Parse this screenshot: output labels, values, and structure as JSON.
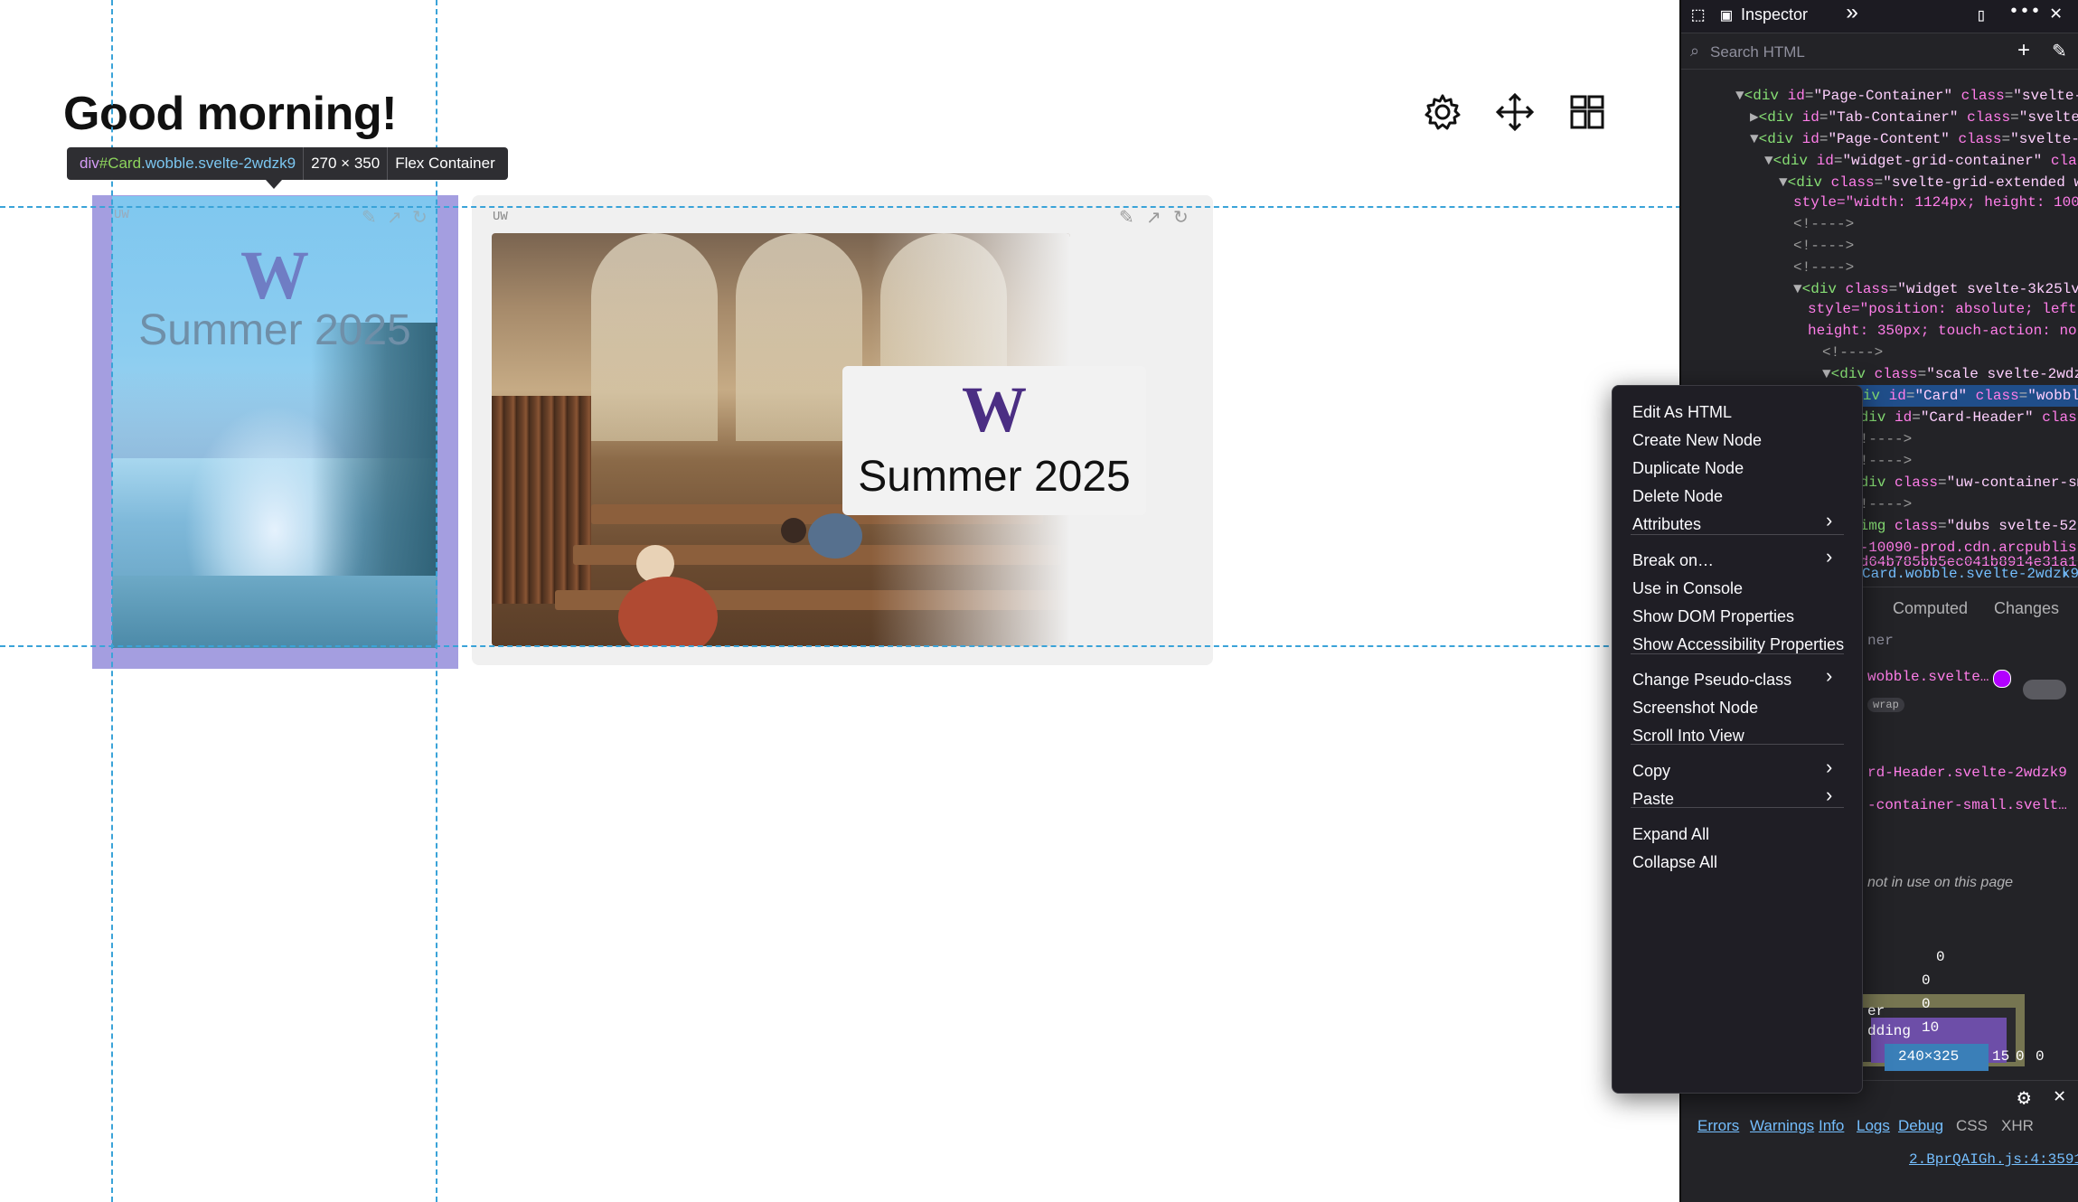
{
  "page": {
    "greeting": "Good morning!",
    "toolbar": {
      "settings_icon": "gear-icon",
      "move_icon": "move-arrows-icon",
      "layout_icon": "grid-layout-icon"
    },
    "tooltip": {
      "tag": "div",
      "id": "#Card",
      "classes": ".wobble.svelte-2wdzk9",
      "size": "270 × 350",
      "kind": "Flex Container"
    },
    "card1": {
      "label": "UW",
      "logo": "W",
      "title": "Summer 2025"
    },
    "card2": {
      "label": "UW",
      "logo": "W",
      "title": "Summer 2025"
    }
  },
  "devtools": {
    "tab": "Inspector",
    "search_placeholder": "Search HTML",
    "tree": [
      {
        "tag": "div",
        "attr": "id",
        "val": "\"Page-Container\"",
        "attr2": "class",
        "val2": "\"svelte-1"
      },
      {
        "tag": "div",
        "attr": "id",
        "val": "\"Tab-Container\"",
        "attr2": "class",
        "val2": "\"svelte-1"
      },
      {
        "tag": "div",
        "attr": "id",
        "val": "\"Page-Content\"",
        "attr2": "class",
        "val2": "\"svelte-1"
      },
      {
        "tag": "div",
        "attr": "id",
        "val": "\"widget-grid-container\"",
        "attr2": "clas",
        "val2": ""
      },
      {
        "tag": "div",
        "attr": "class",
        "val": "\"svelte-grid-extended wi",
        "attr2": "",
        "val2": ""
      },
      {
        "raw": "style=\"width: 1124px; height: 100%"
      },
      {
        "comment": "<!---->"
      },
      {
        "comment": "<!---->"
      },
      {
        "comment": "<!---->"
      },
      {
        "tag": "div",
        "attr": "class",
        "val": "\"widget svelte-3k25lv",
        "attr2": "",
        "val2": ""
      },
      {
        "raw": "style=\"position: absolute; left:"
      },
      {
        "raw": "height: 350px; touch-action: none"
      },
      {
        "comment": "<!---->"
      },
      {
        "tag": "div",
        "attr": "class",
        "val": "\"scale svelte-2wdzk9",
        "attr2": "",
        "val2": ""
      },
      {
        "tag": "div",
        "attr": "id",
        "val": "\"Card\"",
        "attr2": "class",
        "val2": "\"wobble"
      },
      {
        "tag": "div",
        "attr": "id",
        "val": "\"Card-Header\"",
        "attr2": "class",
        "val2": ""
      },
      {
        "comment": "<!---->"
      },
      {
        "comment": "<!---->"
      },
      {
        "tag": "div",
        "attr": "class",
        "val": "\"uw-container-sm",
        "attr2": "",
        "val2": ""
      },
      {
        "comment": "<!---->"
      },
      {
        "tag": "img",
        "attr": "class",
        "val": "\"dubs svelte-52h",
        "attr2": "",
        "val2": ""
      },
      {
        "raw": "v-10090-prod.cdn.arcpublis"
      },
      {
        "raw": "fd64b785bb5ec041b8914e31a1"
      }
    ],
    "breadcrumb": "Card.wobble.svelte-2wdzk9",
    "side_tabs": {
      "computed": "Computed",
      "changes": "Changes"
    },
    "rules": {
      "filter_hint": "ner",
      "rule1": "wobble.svelte…",
      "badge": "wrap",
      "rule2": "rd-Header.svelte-2wdzk9",
      "rule3": "-container-small.svelt…",
      "note": "not in use on this page"
    },
    "boxmodel": {
      "top": "0",
      "margin": "0",
      "border": "0",
      "border_label": "er",
      "padding_label": "dding",
      "padding": "10",
      "content": "240×325",
      "right_pad": "15",
      "right_border": "0",
      "right_margin": "0"
    },
    "console": {
      "filters": [
        "Errors",
        "Warnings",
        "Info",
        "Logs",
        "Debug",
        "CSS",
        "XHR"
      ],
      "source": "2.BprQAIGh.js:4:3591"
    },
    "context_menu": {
      "items": [
        "Edit As HTML",
        "Create New Node",
        "Duplicate Node",
        "Delete Node",
        "Attributes",
        "Break on…",
        "Use in Console",
        "Show DOM Properties",
        "Show Accessibility Properties",
        "Change Pseudo-class",
        "Screenshot Node",
        "Scroll Into View",
        "Copy",
        "Paste",
        "Expand All",
        "Collapse All"
      ]
    }
  }
}
